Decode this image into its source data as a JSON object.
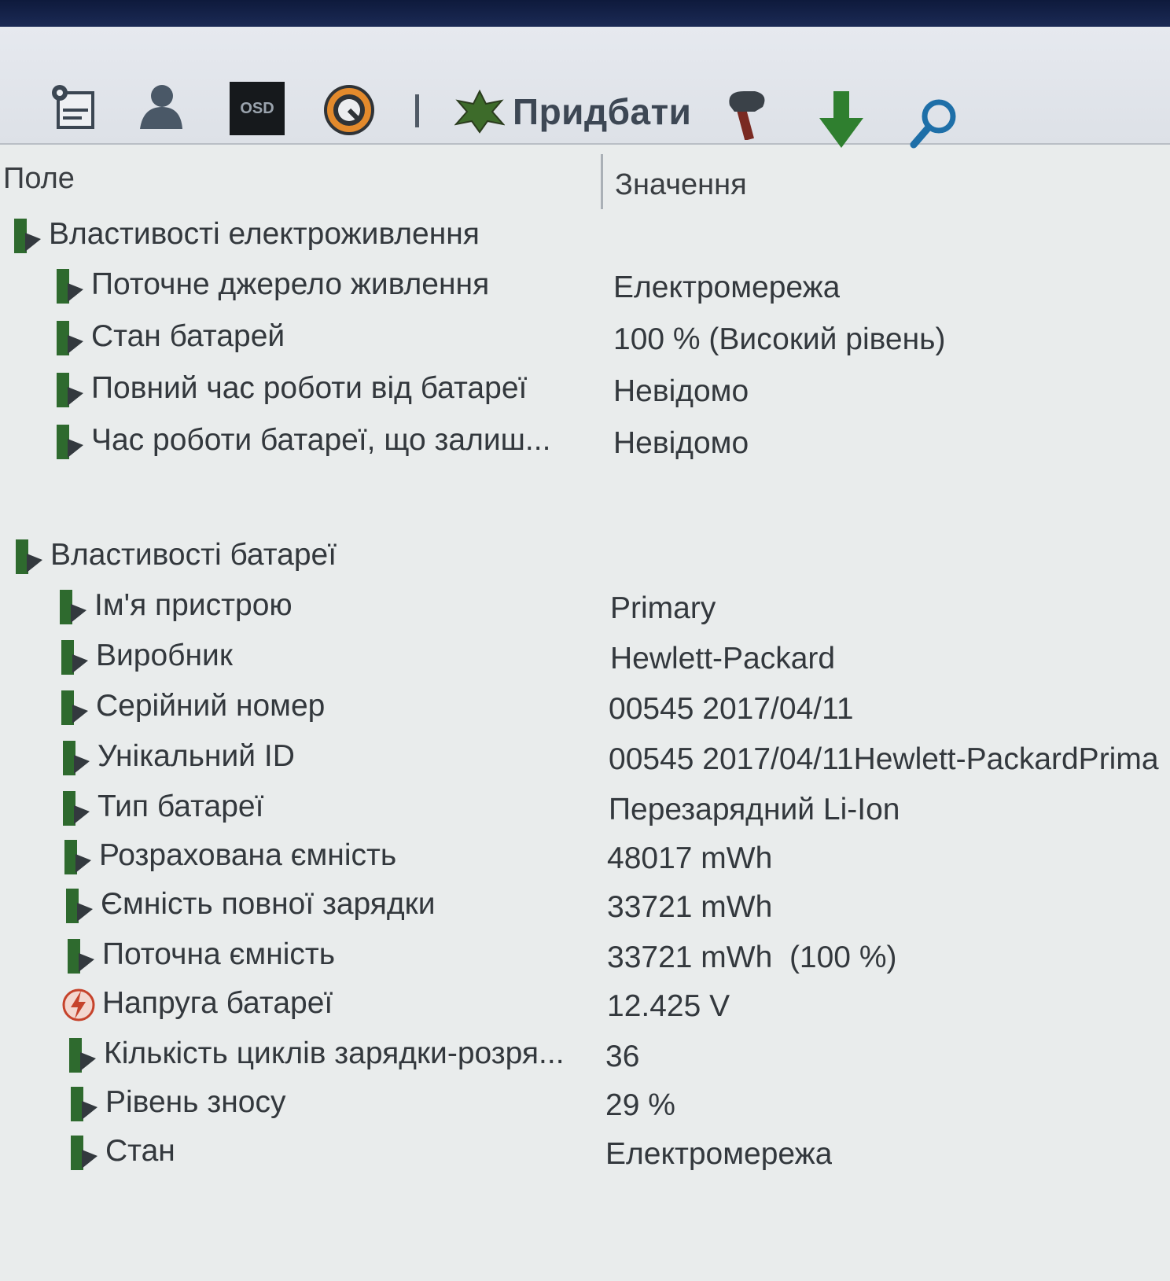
{
  "toolbar": {
    "buttons": [
      {
        "name": "report-icon"
      },
      {
        "name": "user-icon"
      },
      {
        "name": "osd-icon",
        "text": "OSD"
      },
      {
        "name": "gauge-icon"
      }
    ],
    "buy_label": "Придбати",
    "tools": [
      {
        "name": "wrench-icon"
      },
      {
        "name": "download-arrow-icon"
      },
      {
        "name": "search-icon"
      }
    ]
  },
  "columns": {
    "field": "Поле",
    "value": "Значення"
  },
  "groups": [
    {
      "title": "Властивості електроживлення",
      "items": [
        {
          "field": "Поточне джерело живлення",
          "value": "Електромережа",
          "icon": "battery-icon"
        },
        {
          "field": "Стан батарей",
          "value": "100 % (Високий рівень)",
          "icon": "battery-icon"
        },
        {
          "field": "Повний час роботи від батареї",
          "value": "Невідомо",
          "icon": "battery-icon"
        },
        {
          "field": "Час роботи батареї, що залиш...",
          "value": "Невідомо",
          "icon": "battery-icon"
        }
      ]
    },
    {
      "title": "Властивості батареї",
      "items": [
        {
          "field": "Ім'я пристрою",
          "value": "Primary",
          "icon": "battery-icon"
        },
        {
          "field": "Виробник",
          "value": "Hewlett-Packard",
          "icon": "battery-icon"
        },
        {
          "field": "Серійний номер",
          "value": "00545 2017/04/11",
          "icon": "battery-icon"
        },
        {
          "field": "Унікальний ID",
          "value": "00545 2017/04/11Hewlett-PackardPrima",
          "icon": "battery-icon"
        },
        {
          "field": "Тип батареї",
          "value": "Перезарядний Li-Ion",
          "icon": "battery-icon"
        },
        {
          "field": "Розрахована ємність",
          "value": "48017 mWh",
          "icon": "battery-icon"
        },
        {
          "field": "Ємність повної зарядки",
          "value": "33721 mWh",
          "icon": "battery-icon"
        },
        {
          "field": "Поточна ємність",
          "value": "33721 mWh  (100 %)",
          "icon": "battery-icon"
        },
        {
          "field": "Напруга батареї",
          "value": "12.425 V",
          "icon": "voltage-icon"
        },
        {
          "field": "Кількість циклів зарядки-розря...",
          "value": "36",
          "icon": "battery-icon"
        },
        {
          "field": "Рівень зносу",
          "value": "29 %",
          "icon": "battery-icon"
        },
        {
          "field": "Стан",
          "value": "Електромережа",
          "icon": "battery-icon"
        }
      ]
    }
  ]
}
